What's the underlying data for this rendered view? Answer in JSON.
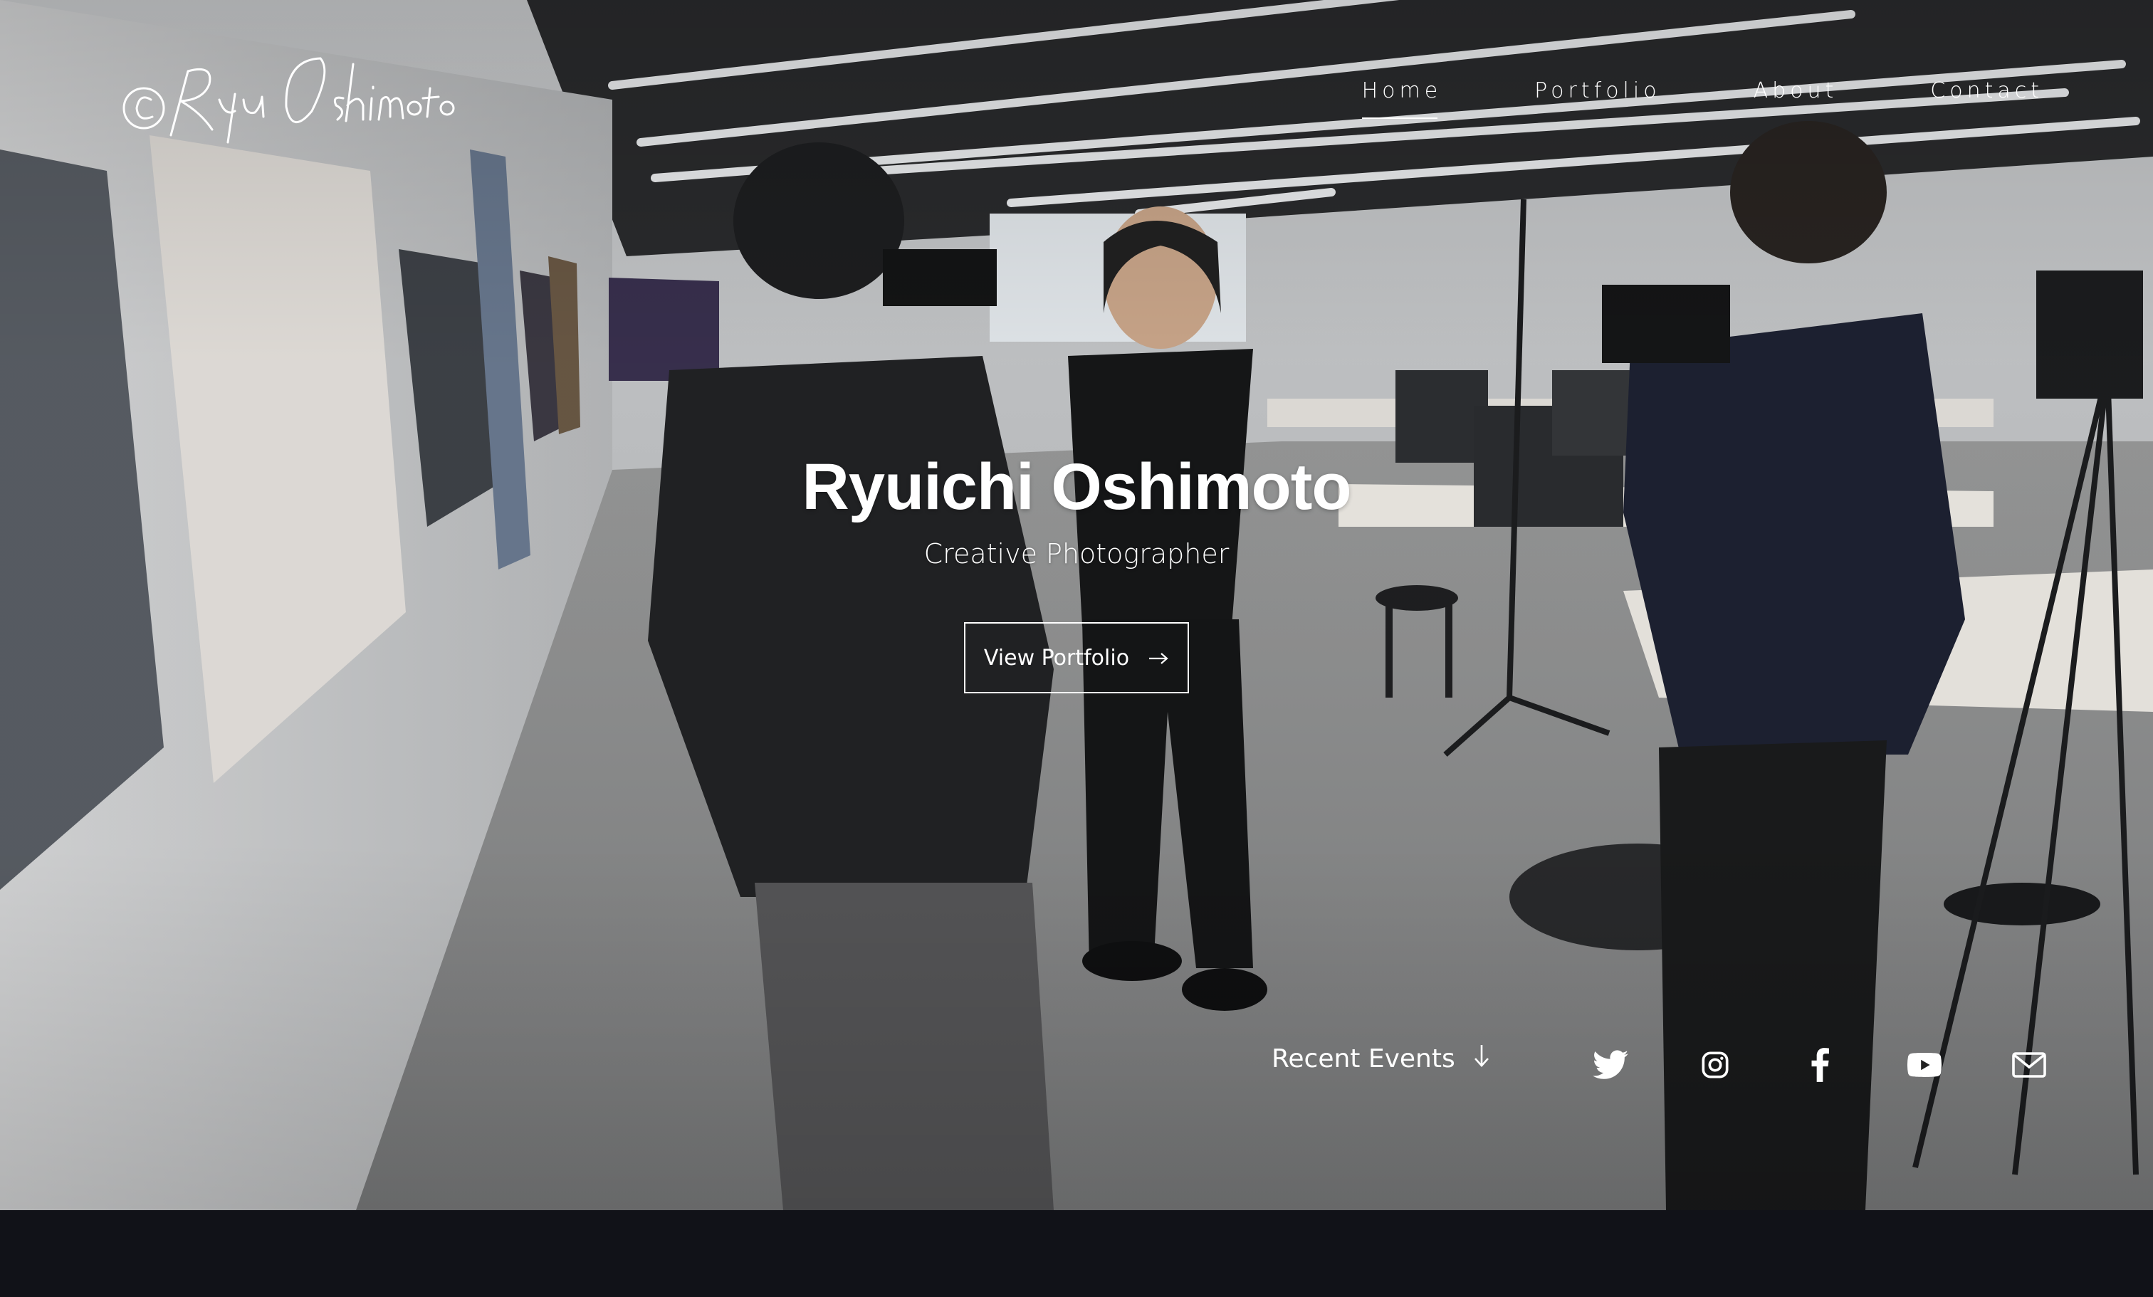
{
  "site": {
    "logo_text": "©Ryu Oshimoto"
  },
  "nav": {
    "items": [
      {
        "label": "Home",
        "active": true
      },
      {
        "label": "Portfolio",
        "active": false
      },
      {
        "label": "About",
        "active": false
      },
      {
        "label": "Contact",
        "active": false
      }
    ]
  },
  "hero": {
    "title": "Ryuichi Oshimoto",
    "subtitle": "Creative Photographer",
    "cta_label": "View Portfolio",
    "cta_icon": "arrow-right-icon",
    "background_description_icon": "studio-photo"
  },
  "recent_events": {
    "label": "Recent Events",
    "icon": "arrow-down-icon"
  },
  "social": [
    {
      "name": "twitter-icon"
    },
    {
      "name": "instagram-icon"
    },
    {
      "name": "facebook-icon"
    },
    {
      "name": "youtube-icon"
    },
    {
      "name": "mail-icon"
    }
  ],
  "colors": {
    "text": "#ffffff",
    "footer_bg": "#111218"
  }
}
